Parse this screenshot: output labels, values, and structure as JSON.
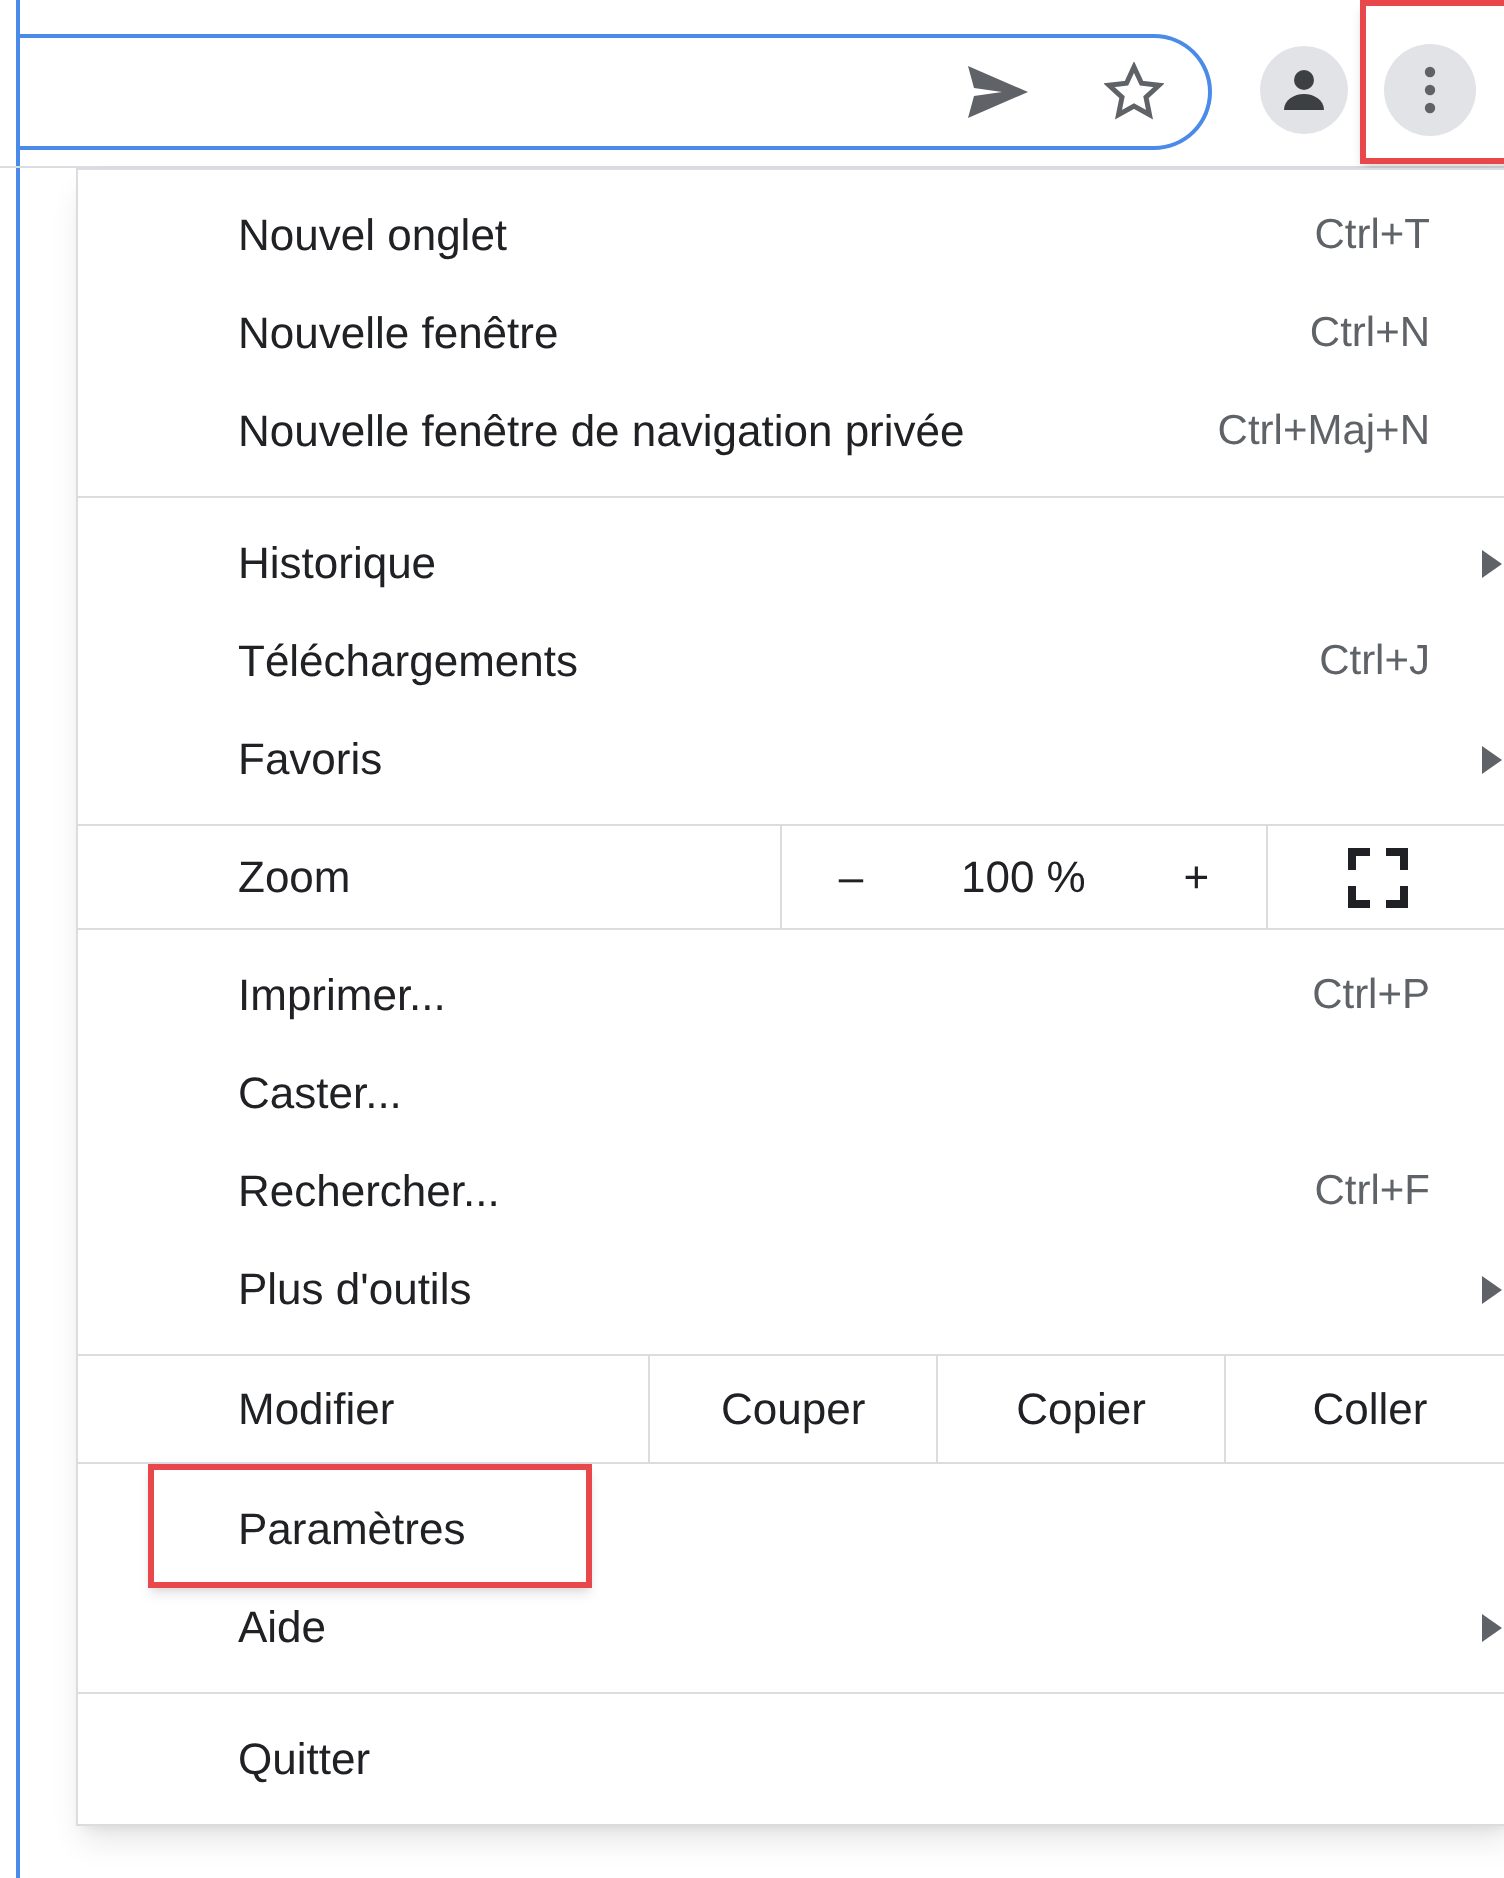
{
  "toolbar": {
    "menu_button": {
      "highlighted": true
    }
  },
  "menu": {
    "sections": [
      {
        "items": [
          {
            "kind": "item",
            "label": "Nouvel onglet",
            "shortcut": "Ctrl+T",
            "submenu": false,
            "highlighted": false
          },
          {
            "kind": "item",
            "label": "Nouvelle fenêtre",
            "shortcut": "Ctrl+N",
            "submenu": false,
            "highlighted": false
          },
          {
            "kind": "item",
            "label": "Nouvelle fenêtre de navigation privée",
            "shortcut": "Ctrl+Maj+N",
            "submenu": false,
            "highlighted": false
          }
        ]
      },
      {
        "items": [
          {
            "kind": "item",
            "label": "Historique",
            "submenu": true,
            "highlighted": false
          },
          {
            "kind": "item",
            "label": "Téléchargements",
            "shortcut": "Ctrl+J",
            "submenu": false,
            "highlighted": false
          },
          {
            "kind": "item",
            "label": "Favoris",
            "submenu": true,
            "highlighted": false
          }
        ]
      },
      {
        "items": [
          {
            "kind": "zoom",
            "label": "Zoom",
            "minus": "–",
            "value": "100 %",
            "plus": "+"
          }
        ]
      },
      {
        "items": [
          {
            "kind": "item",
            "label": "Imprimer...",
            "shortcut": "Ctrl+P",
            "submenu": false,
            "highlighted": false
          },
          {
            "kind": "item",
            "label": "Caster...",
            "submenu": false,
            "highlighted": false
          },
          {
            "kind": "item",
            "label": "Rechercher...",
            "shortcut": "Ctrl+F",
            "submenu": false,
            "highlighted": false
          },
          {
            "kind": "item",
            "label": "Plus d'outils",
            "submenu": true,
            "highlighted": false
          }
        ]
      },
      {
        "items": [
          {
            "kind": "edit",
            "label": "Modifier",
            "actions": [
              "Couper",
              "Copier",
              "Coller"
            ]
          }
        ]
      },
      {
        "items": [
          {
            "kind": "item",
            "label": "Paramètres",
            "submenu": false,
            "highlighted": true
          },
          {
            "kind": "item",
            "label": "Aide",
            "submenu": true,
            "highlighted": false
          }
        ]
      },
      {
        "items": [
          {
            "kind": "item",
            "label": "Quitter",
            "submenu": false,
            "highlighted": false
          }
        ]
      }
    ]
  }
}
